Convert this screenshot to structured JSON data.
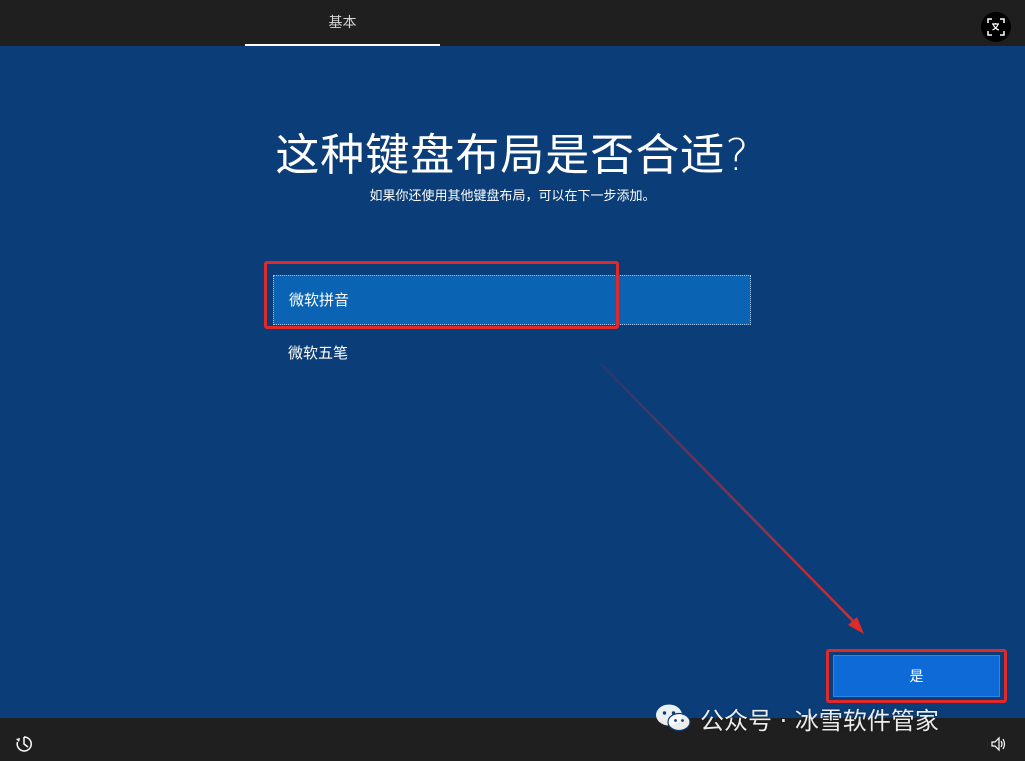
{
  "header": {
    "tab_label": "基本"
  },
  "main": {
    "title": "这种键盘布局是否合适?",
    "subtitle": "如果你还使用其他键盘布局，可以在下一步添加。",
    "options": [
      {
        "label": "微软拼音",
        "selected": true
      },
      {
        "label": "微软五笔",
        "selected": false
      }
    ],
    "confirm_label": "是"
  },
  "watermark": {
    "text": "公众号 · 冰雪软件管家"
  },
  "colors": {
    "background": "#0b3d78",
    "bar": "#1f1f1f",
    "selected_option": "#0a63b3",
    "button": "#0d6ad7",
    "annotation_red": "#e02a2a"
  },
  "icons": {
    "accessibility": "translate-icon",
    "ease_of_access": "ease-of-access-icon",
    "volume": "volume-icon",
    "watermark": "wechat-icon"
  }
}
